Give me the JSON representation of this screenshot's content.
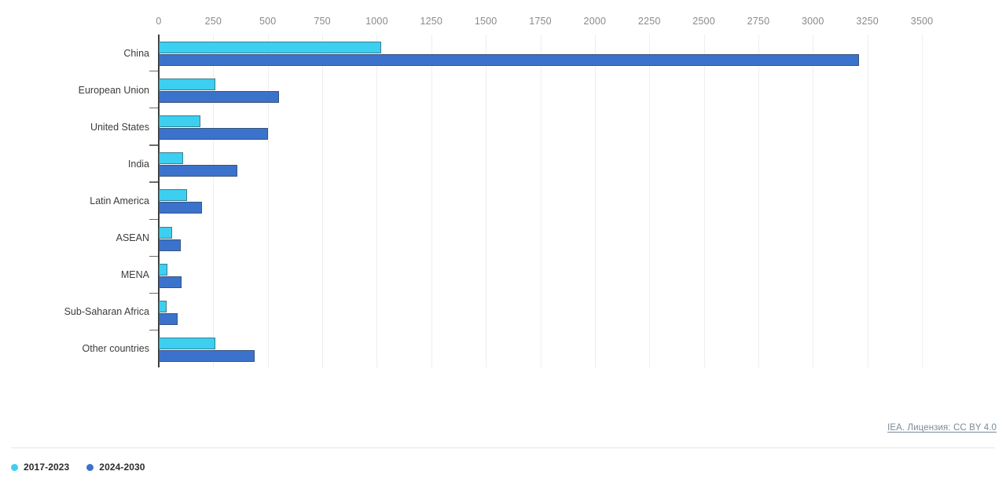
{
  "chart_data": {
    "type": "bar",
    "orientation": "horizontal",
    "title": "",
    "subtitle": "",
    "xlabel": "",
    "ylabel": "",
    "xlim": [
      0,
      3500
    ],
    "xticks": [
      0,
      250,
      500,
      750,
      1000,
      1250,
      1500,
      1750,
      2000,
      2250,
      2500,
      2750,
      3000,
      3250,
      3500
    ],
    "tick_labels": [
      "0",
      "250",
      "500",
      "750",
      "1000",
      "1250",
      "1500",
      "1750",
      "2000",
      "2250",
      "2500",
      "2750",
      "3000",
      "3250",
      "3500"
    ],
    "grid": true,
    "legend_position": "bottom-left",
    "categories": [
      "China",
      "European Union",
      "United States",
      "India",
      "Latin America",
      "ASEAN",
      "MENA",
      "Sub-Saharan Africa",
      "Other countries"
    ],
    "series": [
      {
        "name": "2017-2023",
        "color": "#3ccff0",
        "values": [
          1020,
          260,
          190,
          110,
          130,
          60,
          40,
          35,
          260
        ]
      },
      {
        "name": "2024-2030",
        "color": "#3b72cc",
        "values": [
          3210,
          550,
          500,
          360,
          200,
          100,
          105,
          85,
          440
        ]
      }
    ]
  },
  "footer": {
    "credit": "IEA. Лицензия: CC BY 4.0"
  }
}
